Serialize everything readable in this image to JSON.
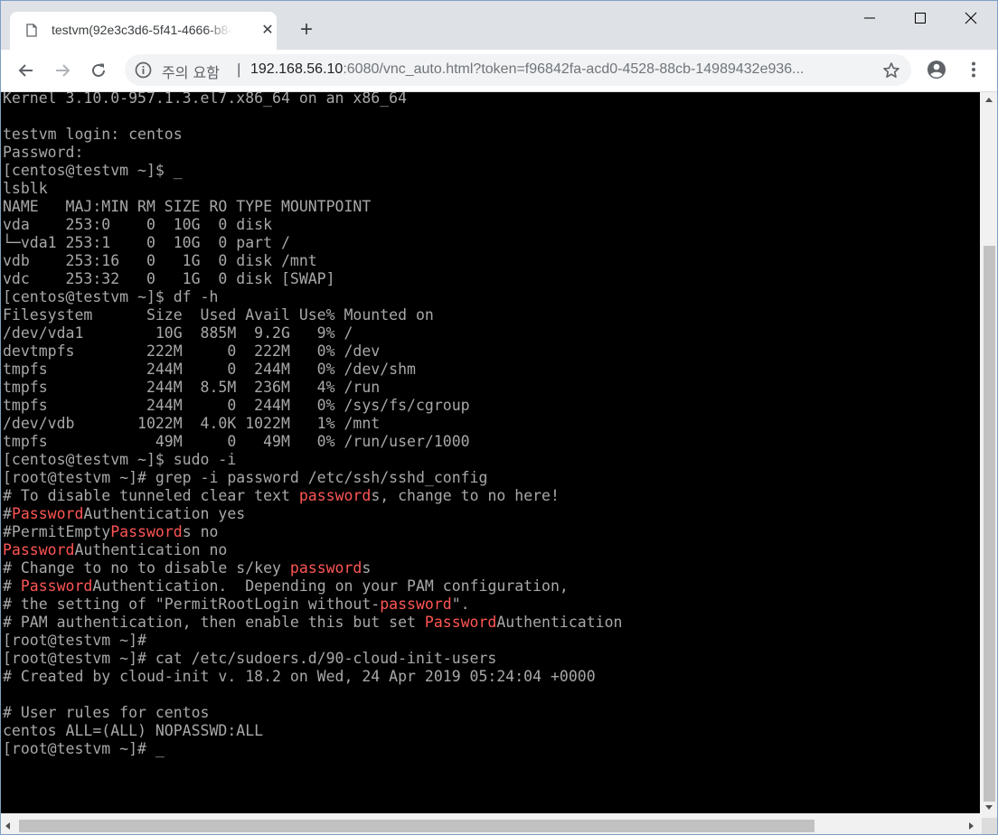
{
  "browser": {
    "tab_title": "testvm(92e3c3d6-5f41-4666-b84",
    "tab_close": "✕",
    "new_tab": "+",
    "security_label": "주의 요함",
    "divider": "|",
    "url_host": "192.168.56.10",
    "url_rest": ":6080/vnc_auto.html?token=f96842fa-acd0-4528-88cb-14989432e936...",
    "icons": [
      "page-icon",
      "close-icon",
      "plus-icon",
      "minimize-icon",
      "maximize-icon",
      "window-close-icon",
      "back-arrow-icon",
      "forward-arrow-icon",
      "reload-icon",
      "info-icon",
      "star-icon",
      "account-icon",
      "more-vert-icon"
    ]
  },
  "colors": {
    "terminal_bg": "#000000",
    "terminal_text": "#a8a8a8",
    "match_highlight": "#ff5555"
  },
  "terminal": {
    "lines": [
      [
        "Kernel 3.10.0-957.1.3.el7.x86_64 on an x86_64"
      ],
      [
        ""
      ],
      [
        "testvm login: centos"
      ],
      [
        "Password:"
      ],
      [
        "[centos@testvm ~]$ _"
      ],
      [
        "lsblk"
      ],
      [
        "NAME   MAJ:MIN RM SIZE RO TYPE MOUNTPOINT"
      ],
      [
        "vda    253:0    0  10G  0 disk"
      ],
      [
        "└─vda1 253:1    0  10G  0 part /"
      ],
      [
        "vdb    253:16   0   1G  0 disk /mnt"
      ],
      [
        "vdc    253:32   0   1G  0 disk [SWAP]"
      ],
      [
        "[centos@testvm ~]$ df -h"
      ],
      [
        "Filesystem      Size  Used Avail Use% Mounted on"
      ],
      [
        "/dev/vda1        10G  885M  9.2G   9% /"
      ],
      [
        "devtmpfs        222M     0  222M   0% /dev"
      ],
      [
        "tmpfs           244M     0  244M   0% /dev/shm"
      ],
      [
        "tmpfs           244M  8.5M  236M   4% /run"
      ],
      [
        "tmpfs           244M     0  244M   0% /sys/fs/cgroup"
      ],
      [
        "/dev/vdb       1022M  4.0K 1022M   1% /mnt"
      ],
      [
        "tmpfs            49M     0   49M   0% /run/user/1000"
      ],
      [
        "[centos@testvm ~]$ sudo -i"
      ],
      [
        "[root@testvm ~]# grep -i password /etc/ssh/sshd_config"
      ],
      [
        "# To disable tunneled clear text ",
        "#password",
        "s, change to no here!"
      ],
      [
        "#",
        "#Password",
        "Authentication yes"
      ],
      [
        "#PermitEmpty",
        "#Password",
        "s no"
      ],
      [
        "#Password",
        "Authentication no"
      ],
      [
        "# Change to no to disable s/key ",
        "#password",
        "s"
      ],
      [
        "# ",
        "#Password",
        "Authentication.  Depending on your PAM configuration,"
      ],
      [
        "# the setting of \"PermitRootLogin without-",
        "#password",
        "\"."
      ],
      [
        "# PAM authentication, then enable this but set ",
        "#Password",
        "Authentication"
      ],
      [
        "[root@testvm ~]#"
      ],
      [
        "[root@testvm ~]# cat /etc/sudoers.d/90-cloud-init-users"
      ],
      [
        "# Created by cloud-init v. 18.2 on Wed, 24 Apr 2019 05:24:04 +0000"
      ],
      [
        ""
      ],
      [
        "# User rules for centos"
      ],
      [
        "centos ALL=(ALL) NOPASSWD:ALL"
      ],
      [
        "[root@testvm ~]# _"
      ]
    ]
  }
}
